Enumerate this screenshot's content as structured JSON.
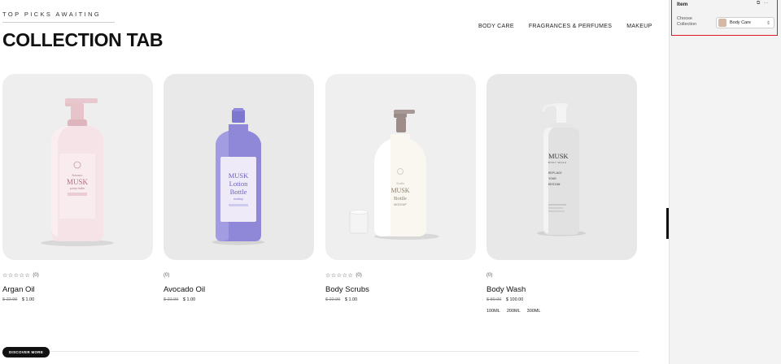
{
  "header": {
    "kicker": "TOP PICKS AWAITING",
    "title": "COLLECTION TAB"
  },
  "tabs": [
    "BODY CARE",
    "FRAGRANCES & PERFUMES",
    "MAKEUP"
  ],
  "products": [
    {
      "name": "Argan Oil",
      "stars": "☆☆☆☆☆",
      "review_count": "(0)",
      "old_price": "$ 22.99",
      "price": "$ 1.00",
      "label_brand": "Navaro",
      "label_main": "MUSK",
      "label_sub": "pump bottle"
    },
    {
      "name": "Avocado Oil",
      "stars": "",
      "review_count": "(0)",
      "old_price": "$ 22.99",
      "price": "$ 1.00",
      "label_main1": "MUSK",
      "label_main2": "Lotion",
      "label_main3": "Bottle",
      "label_sub": "mockup"
    },
    {
      "name": "Body Scrubs",
      "stars": "☆☆☆☆☆",
      "review_count": "(0)",
      "old_price": "$ 22.99",
      "price": "$ 1.00",
      "label_brand": "Sodio",
      "label_main1": "MUSK",
      "label_main2": "Bottle",
      "label_sub": "MOCKUP"
    },
    {
      "name": "Body Wash",
      "stars": "",
      "review_count": "(0)",
      "old_price": "$ 80.00",
      "price": "$ 100.00",
      "label_main": "MUSK",
      "label_sub": "BODY WASH",
      "label_lines": [
        "REPLACE",
        "YOUR",
        "DESIGN"
      ],
      "variants": [
        "100ML",
        "200ML",
        "300ML"
      ]
    }
  ],
  "discover_label": "DISCOVER MORE",
  "panel": {
    "title": "Item",
    "icons": [
      "copy-icon",
      "more-icon"
    ],
    "icon_glyphs": [
      "⧉",
      "···"
    ],
    "field_label_line1": "Choose",
    "field_label_line2": "Collection",
    "field_value": "Body Care",
    "chevron": "⇕"
  },
  "colors": {
    "highlight_border": "#e0162b",
    "bottle_pink": "#f4dde1",
    "bottle_purple": "#8e88d8",
    "bottle_cream": "#f8f6ef",
    "bottle_grey": "#e4e4e4"
  }
}
